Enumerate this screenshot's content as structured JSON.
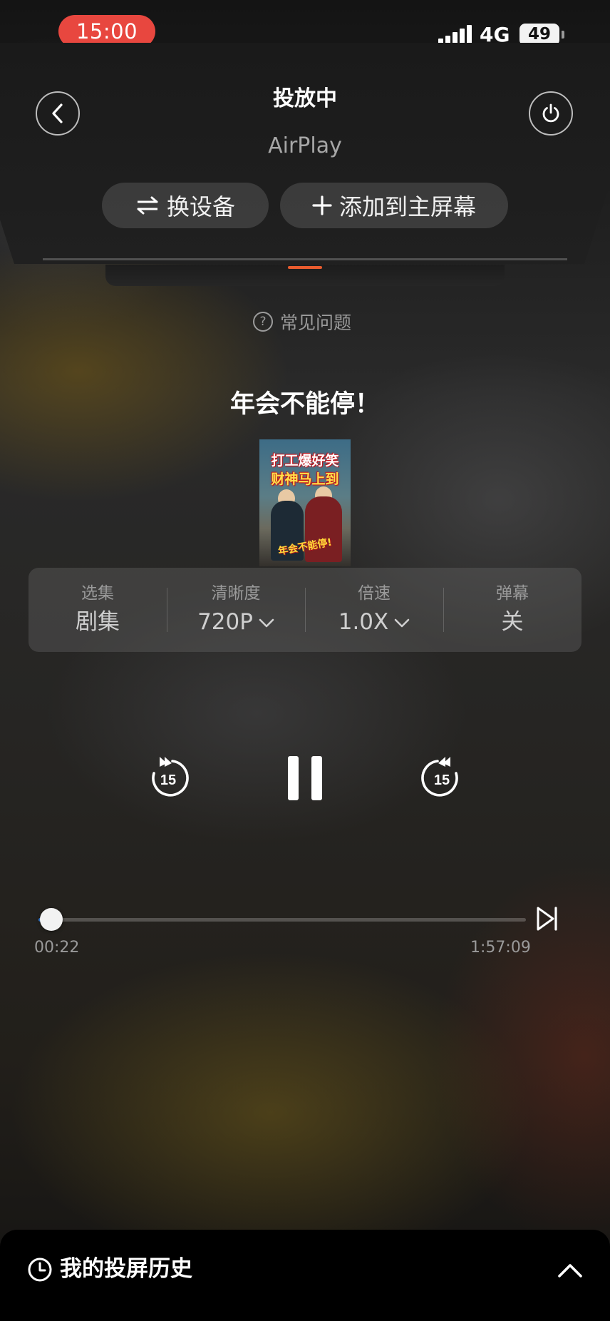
{
  "status_bar": {
    "time": "15:00",
    "network": "4G",
    "battery": "49"
  },
  "header": {
    "title": "投放中",
    "subtitle": "AirPlay",
    "switch_device_label": "换设备",
    "add_home_label": "添加到主屏幕",
    "faq_label": "常见问题",
    "faq_icon_glyph": "?"
  },
  "video": {
    "title": "年会不能停！",
    "poster_text": {
      "line1": "打工爆好笑",
      "line2": "财神马上到",
      "logo": "年会不能停!"
    }
  },
  "settings": [
    {
      "label": "选集",
      "value": "剧集",
      "has_dropdown": false
    },
    {
      "label": "清晰度",
      "value": "720P",
      "has_dropdown": true
    },
    {
      "label": "倍速",
      "value": "1.0X",
      "has_dropdown": true
    },
    {
      "label": "弹幕",
      "value": "关",
      "has_dropdown": false
    }
  ],
  "controls": {
    "rewind_seconds": "15",
    "forward_seconds": "15",
    "state": "playing"
  },
  "progress": {
    "current": "00:22",
    "total": "1:57:09",
    "fraction": 0.0031
  },
  "history": {
    "label": "我的投屏历史"
  },
  "colors": {
    "time_pill": "#e8473f",
    "progress_fill": "#3a8bf2",
    "tv_led": "#e85b2e"
  },
  "icons": {
    "back": "chevron-left-icon",
    "power": "power-icon",
    "switch": "swap-arrows-icon",
    "add": "plus-icon",
    "faq": "question-circle-icon",
    "rewind": "rewind-15-icon",
    "pause": "pause-icon",
    "forward": "forward-15-icon",
    "next": "skip-next-icon",
    "history": "clock-icon",
    "expand": "chevron-up-icon"
  }
}
